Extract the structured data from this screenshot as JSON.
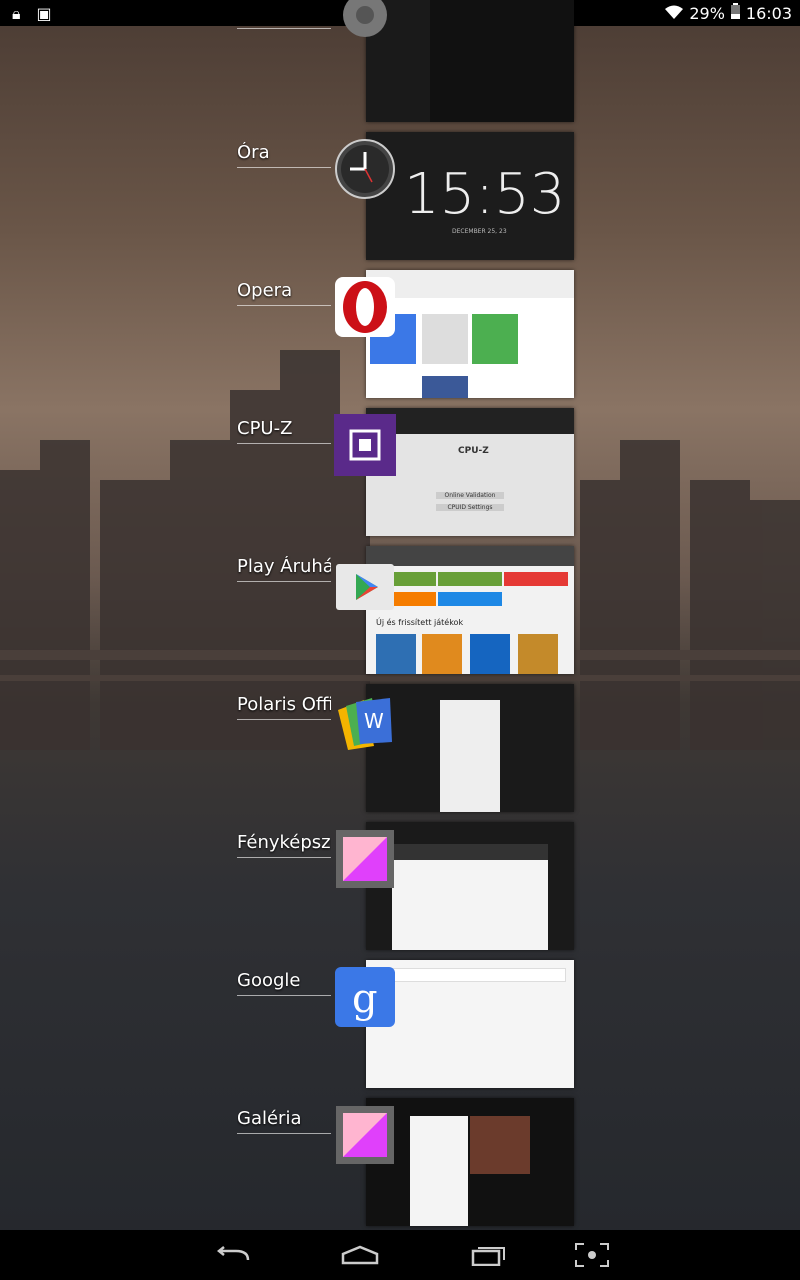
{
  "status_bar": {
    "battery": "29%",
    "time": "16:03"
  },
  "clock_thumb": {
    "time": "15:53",
    "date": "DECEMBER 25, 23"
  },
  "cpuz_thumb": {
    "title": "CPU-Z",
    "btn1": "Online Validation",
    "btn2": "CPUID Settings"
  },
  "play_thumb": {
    "section": "Új és frissített játékok"
  },
  "apps": [
    {
      "label": ""
    },
    {
      "label": "Óra"
    },
    {
      "label": "Opera"
    },
    {
      "label": "CPU-Z"
    },
    {
      "label": "Play Áruház"
    },
    {
      "label": "Polaris Office"
    },
    {
      "label": "Fényképszerkesztő"
    },
    {
      "label": "Google"
    },
    {
      "label": "Galéria"
    }
  ],
  "colors": {
    "opera_red": "#cc1017",
    "cpuz_purple": "#5a2a8a",
    "google_blue": "#3b78e7"
  }
}
